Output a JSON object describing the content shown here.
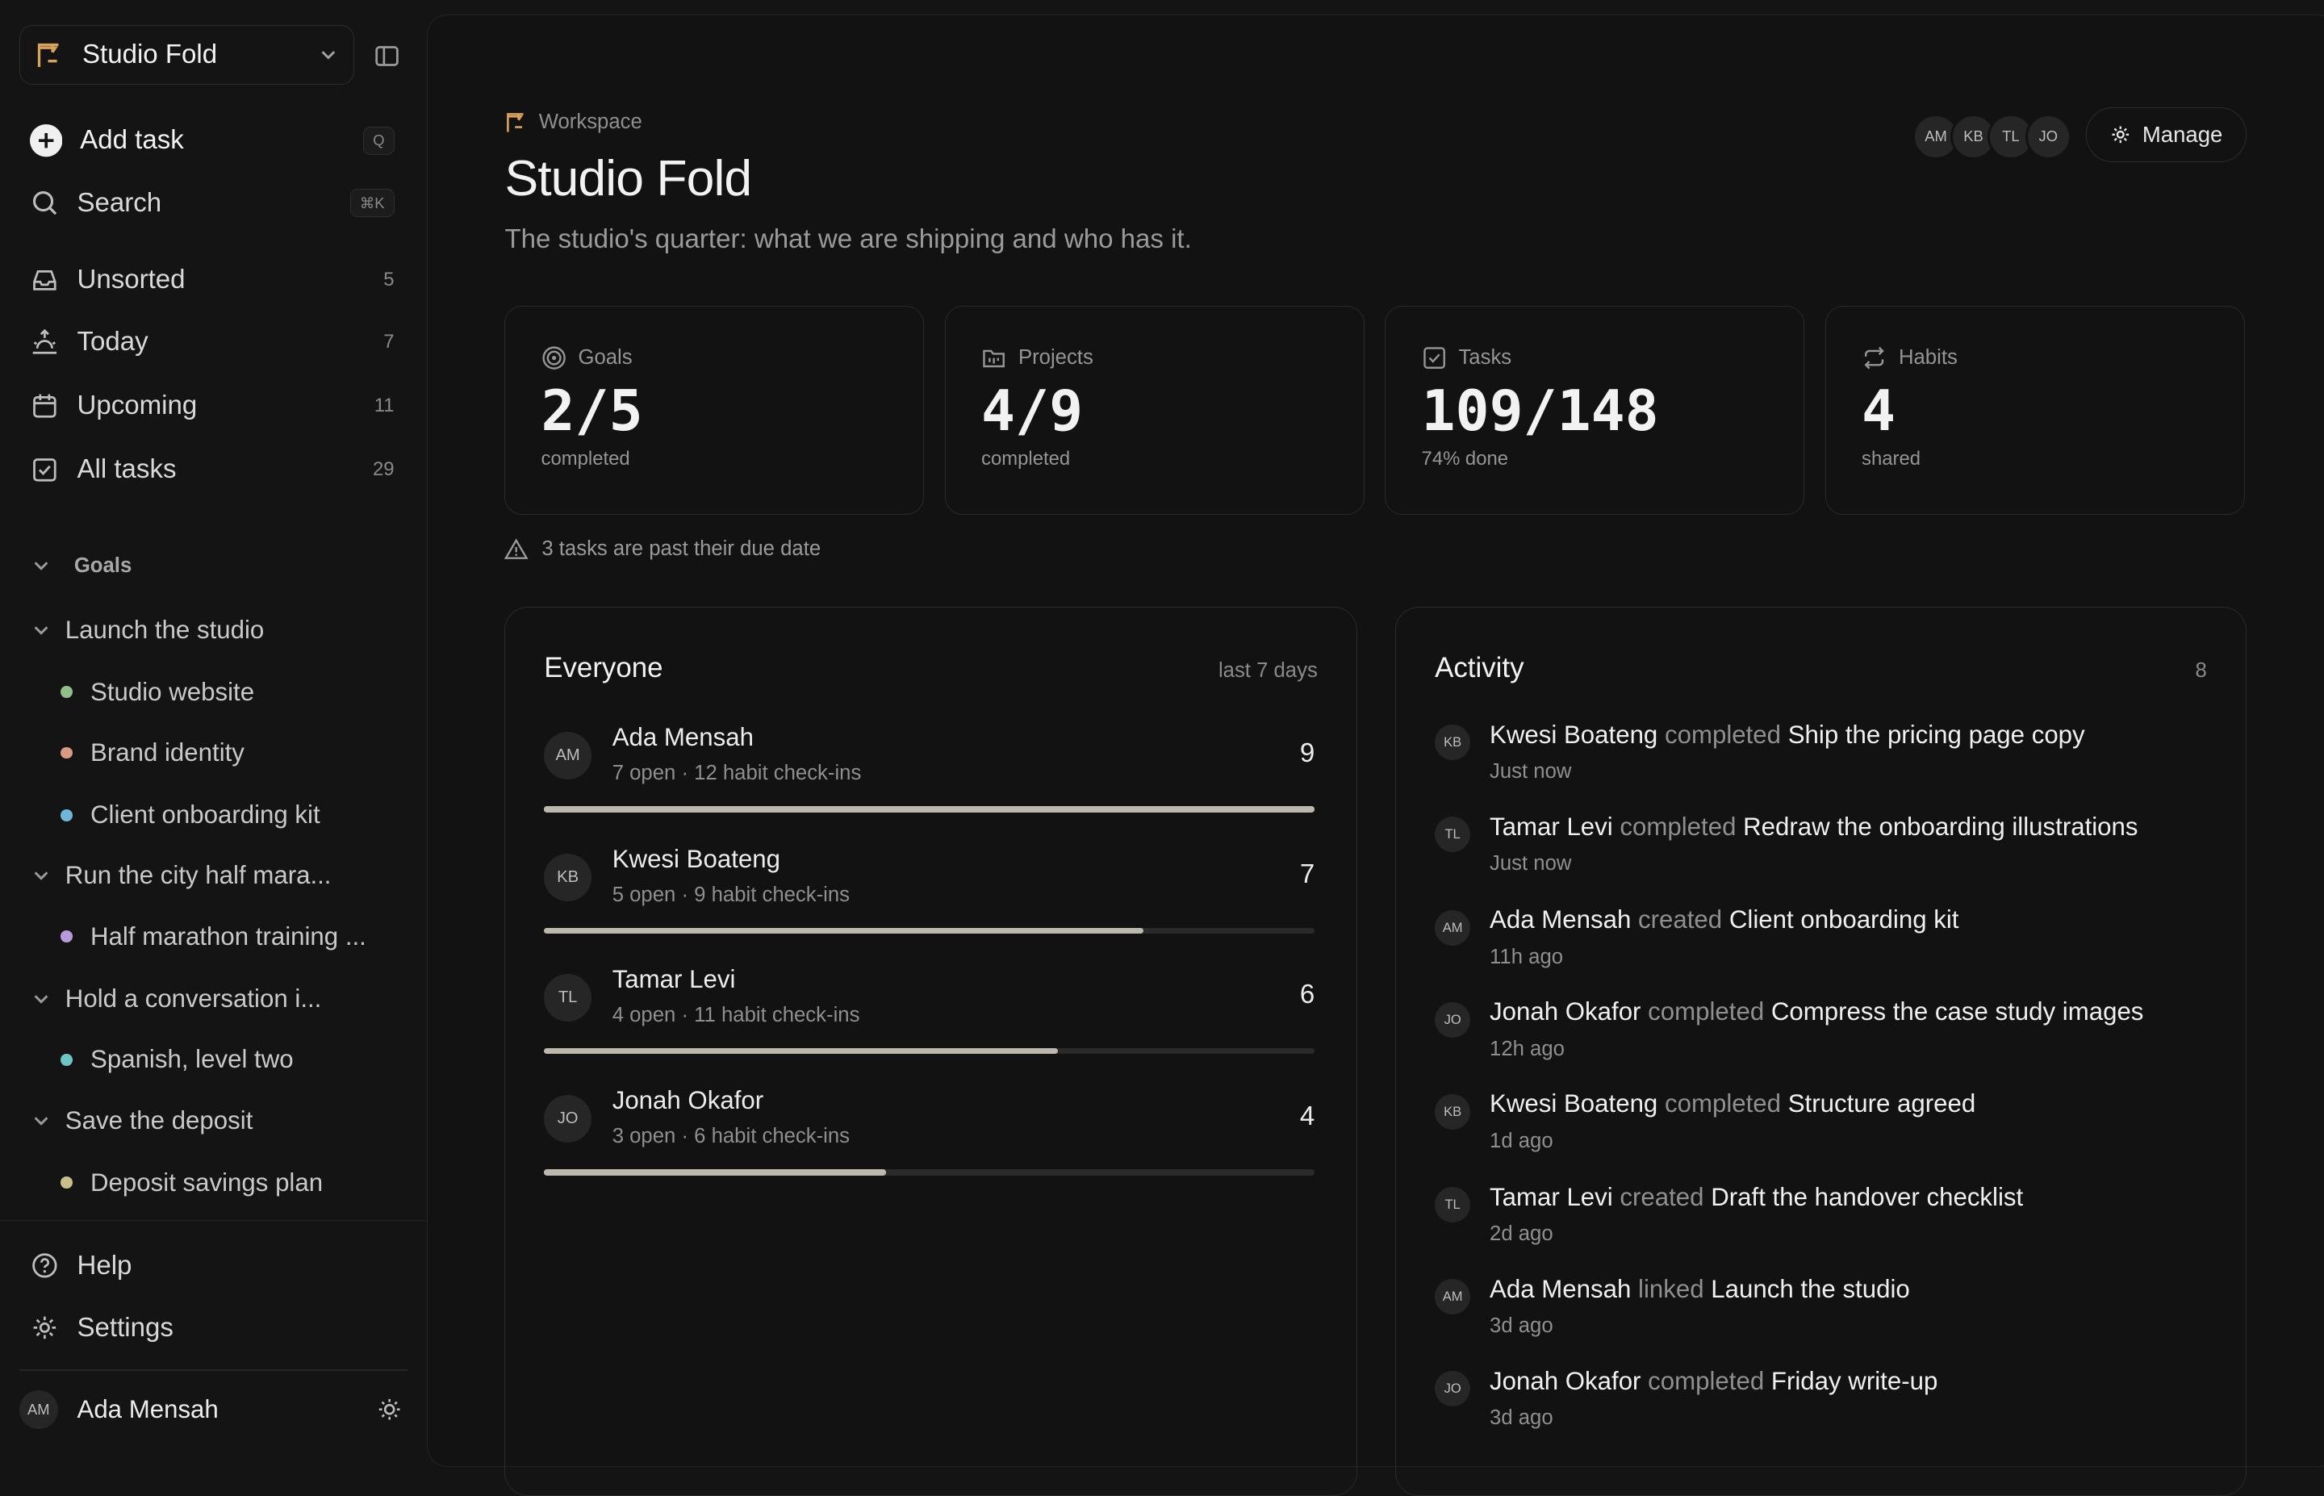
{
  "sidebar": {
    "workspace": "Studio Fold",
    "add_task": "Add task",
    "add_task_shortcut": "Q",
    "search": "Search",
    "search_shortcut": "⌘K",
    "nav": [
      {
        "label": "Unsorted",
        "count": "5"
      },
      {
        "label": "Today",
        "count": "7"
      },
      {
        "label": "Upcoming",
        "count": "11"
      },
      {
        "label": "All tasks",
        "count": "29"
      }
    ],
    "goals_heading": "Goals",
    "goals": [
      {
        "label": "Launch the studio",
        "children": [
          {
            "label": "Studio website",
            "color": "#8fbf8a"
          },
          {
            "label": "Brand identity",
            "color": "#d99a84"
          },
          {
            "label": "Client onboarding kit",
            "color": "#6fb6d8"
          }
        ]
      },
      {
        "label": "Run the city half mara...",
        "children": [
          {
            "label": "Half marathon training ...",
            "color": "#b79ad9"
          }
        ]
      },
      {
        "label": "Hold a conversation i...",
        "children": [
          {
            "label": "Spanish, level two",
            "color": "#6cc4c4"
          }
        ]
      },
      {
        "label": "Save the deposit",
        "children": [
          {
            "label": "Deposit savings plan",
            "color": "#c8c08a"
          }
        ]
      }
    ],
    "help": "Help",
    "settings": "Settings",
    "user": {
      "initials": "AM",
      "name": "Ada Mensah"
    }
  },
  "header": {
    "breadcrumb": "Workspace",
    "title": "Studio Fold",
    "subtitle": "The studio's quarter: what we are shipping and who has it.",
    "avatars": [
      "AM",
      "KB",
      "TL",
      "JO"
    ],
    "manage": "Manage"
  },
  "stats": [
    {
      "label": "Goals",
      "value": "2/5",
      "sub": "completed"
    },
    {
      "label": "Projects",
      "value": "4/9",
      "sub": "completed"
    },
    {
      "label": "Tasks",
      "value": "109/148",
      "sub": "74% done"
    },
    {
      "label": "Habits",
      "value": "4",
      "sub": "shared"
    }
  ],
  "alert": "3 tasks are past their due date",
  "everyone": {
    "title": "Everyone",
    "meta": "last 7 days",
    "members": [
      {
        "initials": "AM",
        "name": "Ada Mensah",
        "sub": "7 open · 12 habit check-ins",
        "count": "9",
        "progress": 1.0
      },
      {
        "initials": "KB",
        "name": "Kwesi Boateng",
        "sub": "5 open · 9 habit check-ins",
        "count": "7",
        "progress": 0.778
      },
      {
        "initials": "TL",
        "name": "Tamar Levi",
        "sub": "4 open · 11 habit check-ins",
        "count": "6",
        "progress": 0.667
      },
      {
        "initials": "JO",
        "name": "Jonah Okafor",
        "sub": "3 open · 6 habit check-ins",
        "count": "4",
        "progress": 0.444
      }
    ]
  },
  "activity": {
    "title": "Activity",
    "count": "8",
    "items": [
      {
        "initials": "KB",
        "who": "Kwesi Boateng",
        "verb": "completed",
        "what": "Ship the pricing page copy",
        "when": "Just now"
      },
      {
        "initials": "TL",
        "who": "Tamar Levi",
        "verb": "completed",
        "what": "Redraw the onboarding illustrations",
        "when": "Just now"
      },
      {
        "initials": "AM",
        "who": "Ada Mensah",
        "verb": "created",
        "what": "Client onboarding kit",
        "when": "11h ago"
      },
      {
        "initials": "JO",
        "who": "Jonah Okafor",
        "verb": "completed",
        "what": "Compress the case study images",
        "when": "12h ago"
      },
      {
        "initials": "KB",
        "who": "Kwesi Boateng",
        "verb": "completed",
        "what": "Structure agreed",
        "when": "1d ago"
      },
      {
        "initials": "TL",
        "who": "Tamar Levi",
        "verb": "created",
        "what": "Draft the handover checklist",
        "when": "2d ago"
      },
      {
        "initials": "AM",
        "who": "Ada Mensah",
        "verb": "linked",
        "what": "Launch the studio",
        "when": "3d ago"
      },
      {
        "initials": "JO",
        "who": "Jonah Okafor",
        "verb": "completed",
        "what": "Friday write-up",
        "when": "3d ago"
      }
    ]
  },
  "colors": {
    "accent_bar": "#bdb8ad",
    "background": "#141414"
  }
}
